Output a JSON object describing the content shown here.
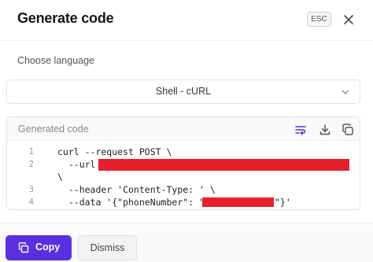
{
  "dialog": {
    "title": "Generate code",
    "esc_label": "ESC"
  },
  "language": {
    "label": "Choose language",
    "selected": "Shell - cURL"
  },
  "code": {
    "header_label": "Generated code",
    "lines": [
      {
        "number": "1",
        "text": "curl --request POST \\"
      },
      {
        "number": "2",
        "text": "  --url "
      },
      {
        "number": "",
        "text": "\\"
      },
      {
        "number": "3",
        "text": "  --header 'Content-Type: ' \\"
      },
      {
        "number": "4",
        "text": "  --data '{\"phoneNumber\": \"",
        "suffix": "\"}'"
      }
    ]
  },
  "footer": {
    "copy_label": "Copy",
    "dismiss_label": "Dismiss"
  },
  "colors": {
    "primary": "#5a2fe0",
    "redaction": "#e8202b"
  },
  "icons": {
    "close": "close-icon",
    "chevron": "chevron-down-icon",
    "wrap": "wrap-text-icon",
    "download": "download-icon",
    "copy": "copy-icon"
  }
}
